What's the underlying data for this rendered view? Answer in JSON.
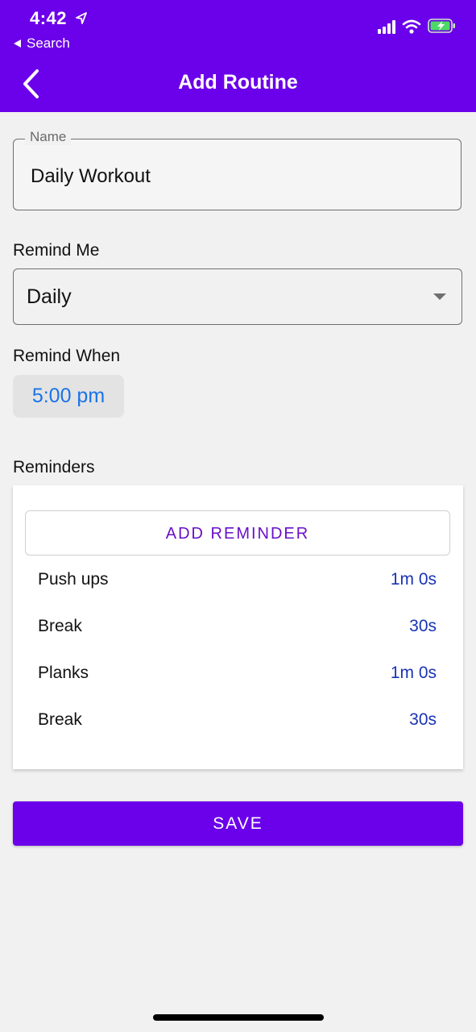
{
  "status_bar": {
    "time": "4:42",
    "back_app": "Search",
    "icons": [
      "location-arrow-icon",
      "cellular-signal-icon",
      "wifi-icon",
      "battery-charging-icon"
    ]
  },
  "nav": {
    "title": "Add Routine",
    "back_icon": "chevron-left-icon"
  },
  "form": {
    "name_label": "Name",
    "name_value": "Daily Workout",
    "remind_me_label": "Remind Me",
    "remind_me_value": "Daily",
    "remind_when_label": "Remind When",
    "remind_when_value": "5:00 pm",
    "reminders_label": "Reminders"
  },
  "reminders": {
    "add_label": "ADD REMINDER",
    "items": [
      {
        "name": "Push ups",
        "duration": "1m 0s"
      },
      {
        "name": "Break",
        "duration": "30s"
      },
      {
        "name": "Planks",
        "duration": "1m 0s"
      },
      {
        "name": "Break",
        "duration": "30s"
      }
    ]
  },
  "actions": {
    "save_label": "SAVE"
  },
  "colors": {
    "primary": "#6b00ea",
    "link_blue": "#1a73e8",
    "duration_blue": "#1933b5",
    "background": "#f1f1f1"
  }
}
